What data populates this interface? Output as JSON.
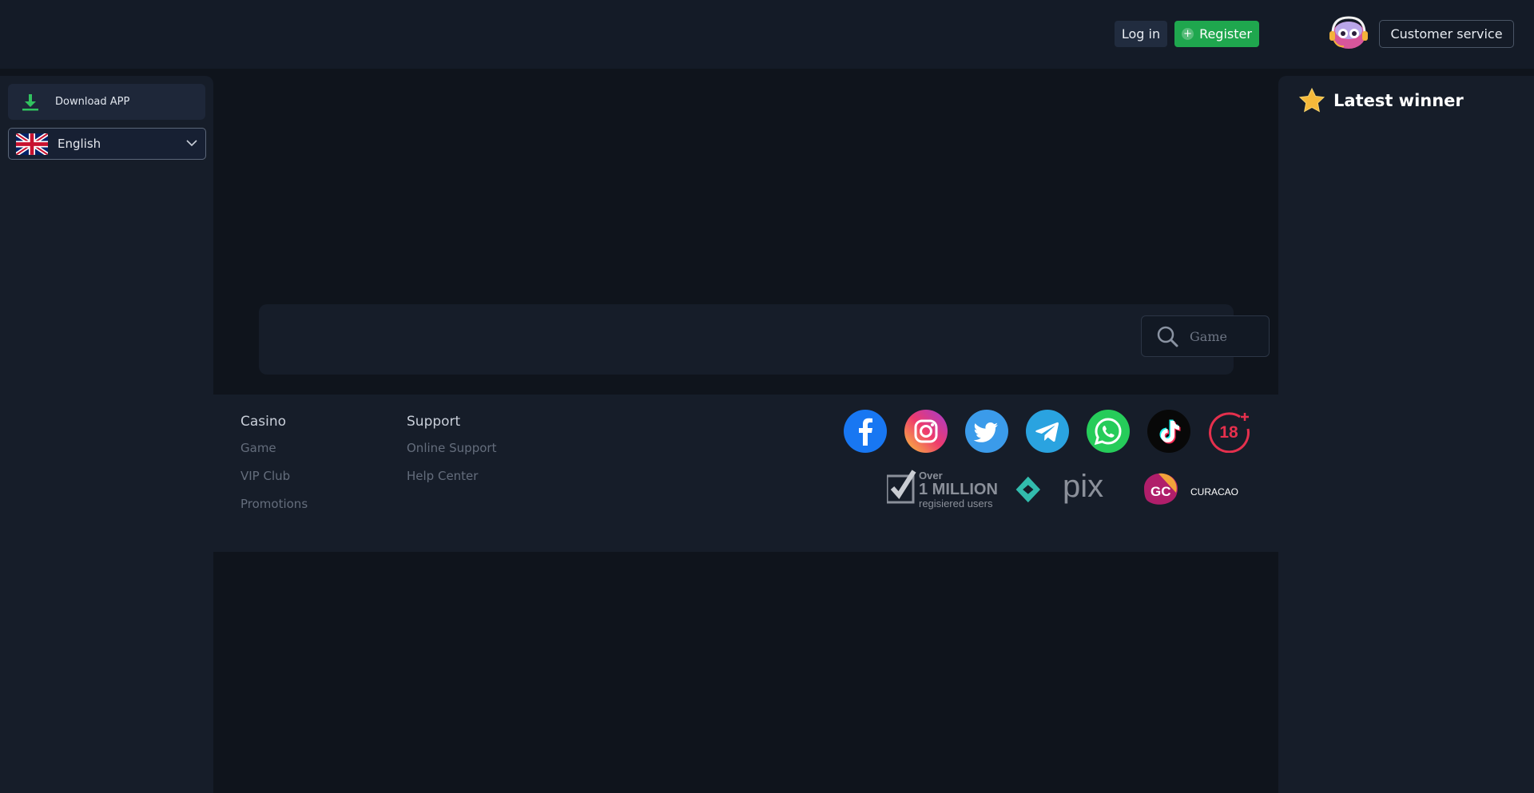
{
  "header": {
    "login_label": "Log in",
    "register_label": "Register",
    "customer_service_label": "Customer service"
  },
  "sidebar": {
    "download_label": "Download APP",
    "language": "English"
  },
  "search": {
    "placeholder": "Game"
  },
  "footer": {
    "casino": {
      "title": "Casino",
      "links": [
        "Game",
        "VIP Club",
        "Promotions"
      ]
    },
    "support": {
      "title": "Support",
      "links": [
        "Online Support",
        "Help Center"
      ]
    },
    "social_icons": [
      "facebook-icon",
      "instagram-icon",
      "twitter-icon",
      "telegram-icon",
      "whatsapp-icon",
      "tiktok-icon",
      "age-18-plus-icon"
    ],
    "badges": {
      "million_over": "Over",
      "million_main": "1 MILLION",
      "million_sub": "regisiered users",
      "pix": "pix",
      "curacao_short": "GC",
      "curacao": "CURACAO"
    }
  },
  "right_sidebar": {
    "title": "Latest winner"
  },
  "colors": {
    "register_green": "#1fa74e",
    "background": "#0f141c",
    "panel": "#161d29"
  }
}
